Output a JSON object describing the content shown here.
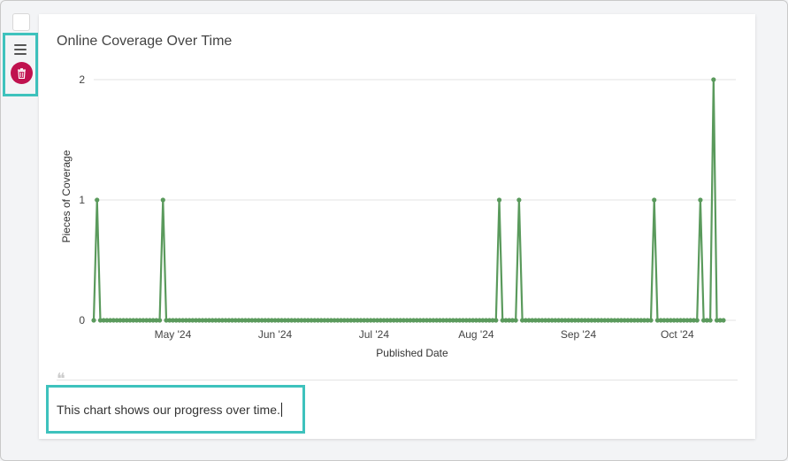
{
  "chart_data": {
    "type": "line",
    "title": "Online Coverage Over Time",
    "xlabel": "Published Date",
    "ylabel": "Pieces of Coverage",
    "ylim": [
      0,
      2
    ],
    "y_ticks": [
      "0",
      "1",
      "2"
    ],
    "x_ticks": [
      "May '24",
      "Jun '24",
      "Jul '24",
      "Aug '24",
      "Sep '24",
      "Oct '24"
    ],
    "x_tick_dates": [
      "2024-05-01",
      "2024-06-01",
      "2024-07-01",
      "2024-08-01",
      "2024-09-01",
      "2024-10-01"
    ],
    "x_range": [
      "2024-04-07",
      "2024-10-15"
    ],
    "grid": "horizontal",
    "series": [
      {
        "color": "#5a9a5c",
        "points": [
          {
            "date": "2024-04-08",
            "value": 1
          },
          {
            "date": "2024-04-28",
            "value": 1
          },
          {
            "date": "2024-08-08",
            "value": 1
          },
          {
            "date": "2024-08-14",
            "value": 1
          },
          {
            "date": "2024-09-24",
            "value": 1
          },
          {
            "date": "2024-10-08",
            "value": 1
          },
          {
            "date": "2024-10-12",
            "value": 2
          }
        ],
        "default_value": 0
      }
    ]
  },
  "caption": {
    "text": "This chart shows our progress over time."
  }
}
